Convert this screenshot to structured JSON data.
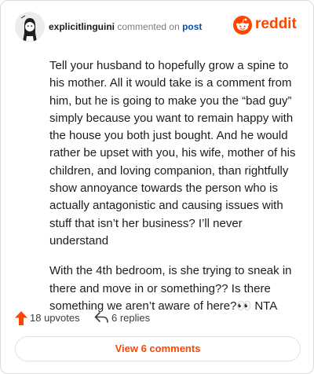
{
  "header": {
    "username": "explicitlinguini",
    "verb": "commented on",
    "post_link": "post",
    "brand_word": "reddit",
    "icons": {
      "avatar": "user-avatar-icon",
      "logo": "reddit-alien-icon"
    }
  },
  "comment": {
    "paragraphs": [
      "Tell your husband to hopefully grow a spine to his mother. All it would take is a comment from him, but he is going to make you the “bad guy” simply because you want to remain happy with the house you both just bought. And he would rather be upset with you, his wife, mother of his children, and loving companion, than rightfully show annoyance towards the person who is actually antagonistic and causing issues with stuff that isn’t her business? I’ll never understand",
      "With the 4th bedroom, is she trying to sneak in there and move in or something?? Is there something we aren’t aware of here?👀 NTA"
    ]
  },
  "actions": {
    "upvotes": "18 upvotes",
    "replies": "6 replies",
    "icons": {
      "upvote": "upvote-arrow-icon",
      "reply": "reply-icon"
    }
  },
  "view_button": "View 6 comments",
  "colors": {
    "accent": "#ff4500",
    "link": "#0a4fa8",
    "text": "#1c1c1c",
    "muted": "#7c7c7c"
  }
}
